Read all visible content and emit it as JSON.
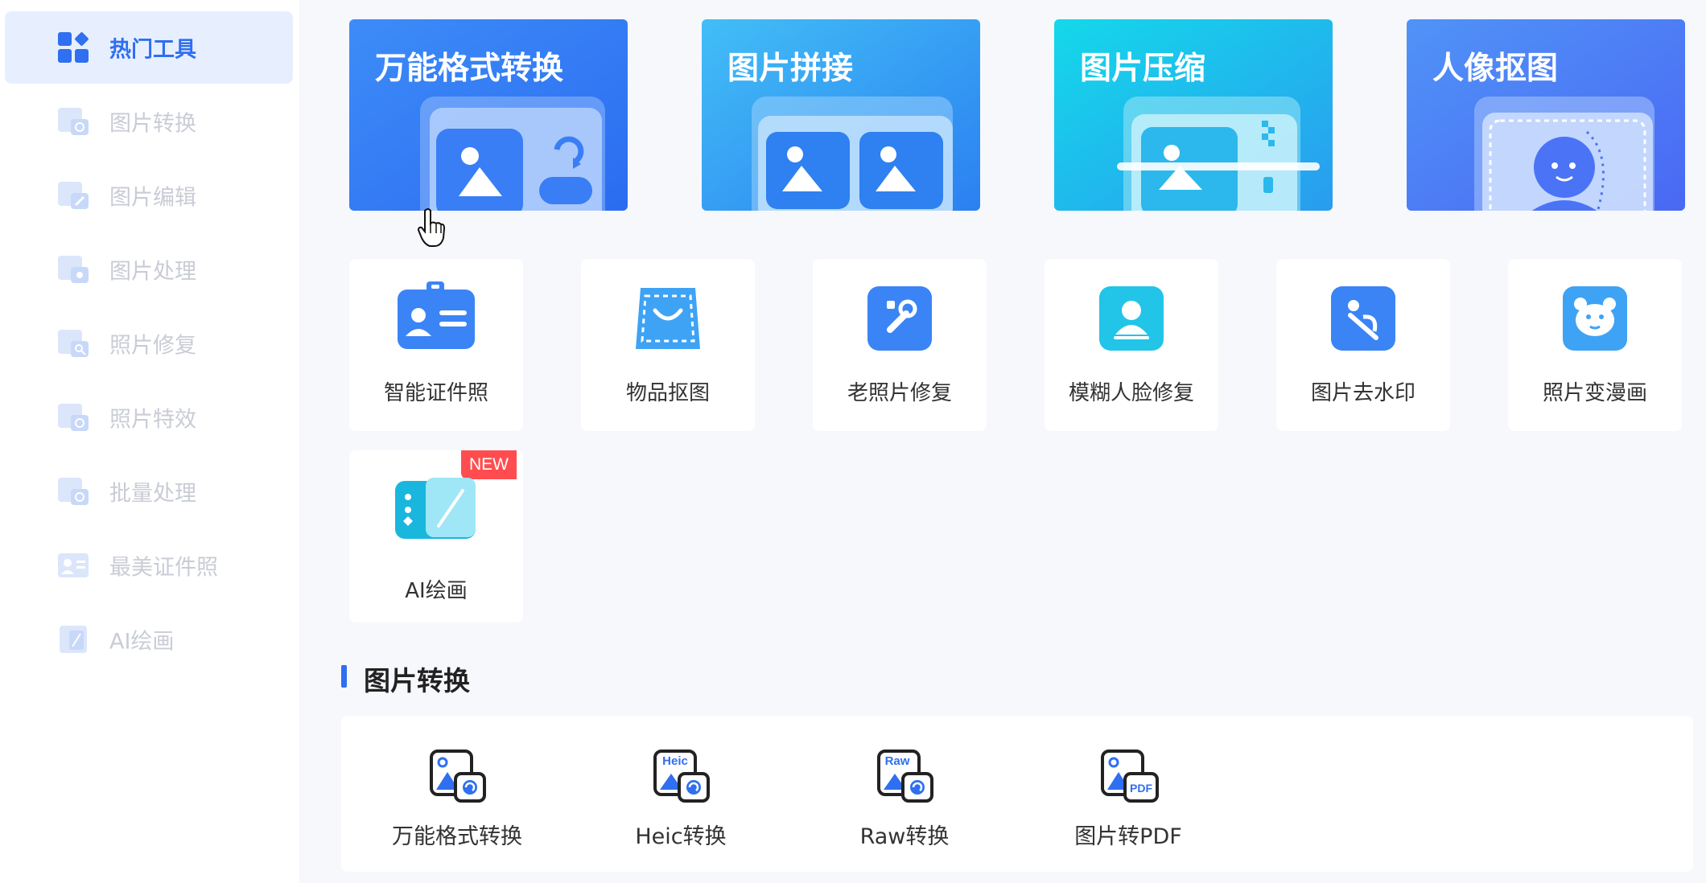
{
  "sidebar": {
    "items": [
      {
        "label": "热门工具",
        "icon": "grid-apps-icon",
        "active": true
      },
      {
        "label": "图片转换",
        "icon": "image-convert-icon"
      },
      {
        "label": "图片编辑",
        "icon": "image-edit-icon"
      },
      {
        "label": "图片处理",
        "icon": "image-process-icon"
      },
      {
        "label": "照片修复",
        "icon": "photo-repair-icon"
      },
      {
        "label": "照片特效",
        "icon": "photo-effect-icon"
      },
      {
        "label": "批量处理",
        "icon": "batch-process-icon"
      },
      {
        "label": "最美证件照",
        "icon": "id-photo-icon"
      },
      {
        "label": "AI绘画",
        "icon": "ai-paint-icon"
      }
    ]
  },
  "banners": [
    {
      "title": "万能格式转换",
      "icon": "format-convert-icon",
      "color_from": "#3b86f7",
      "color_to": "#2f6ff0"
    },
    {
      "title": "图片拼接",
      "icon": "image-stitch-icon",
      "color_from": "#40b8f5",
      "color_to": "#2d86f2"
    },
    {
      "title": "图片压缩",
      "icon": "image-compress-icon",
      "color_from": "#18d3ea",
      "color_to": "#2ba4ef"
    },
    {
      "title": "人像抠图",
      "icon": "portrait-cutout-icon",
      "color_from": "#4f8df6",
      "color_to": "#4a6cf5"
    }
  ],
  "tools": [
    {
      "label": "智能证件照",
      "icon": "id-card-icon"
    },
    {
      "label": "物品抠图",
      "icon": "object-cutout-icon"
    },
    {
      "label": "老照片修复",
      "icon": "old-photo-repair-icon"
    },
    {
      "label": "模糊人脸修复",
      "icon": "blur-face-repair-icon"
    },
    {
      "label": "图片去水印",
      "icon": "remove-watermark-icon"
    },
    {
      "label": "照片变漫画",
      "icon": "photo-to-comic-icon"
    },
    {
      "label": "AI绘画",
      "icon": "ai-painting-icon",
      "badge": "NEW"
    }
  ],
  "section": {
    "title": "图片转换",
    "items": [
      {
        "label": "万能格式转换",
        "icon": "format-convert-icon",
        "tag": ""
      },
      {
        "label": "Heic转换",
        "icon": "heic-convert-icon",
        "tag": "Heic"
      },
      {
        "label": "Raw转换",
        "icon": "raw-convert-icon",
        "tag": "Raw"
      },
      {
        "label": "图片转PDF",
        "icon": "image-to-pdf-icon",
        "tag": "PDF"
      }
    ]
  },
  "colors": {
    "accent": "#2f6ff0",
    "badge": "#ff4d4f",
    "sidebar_inactive": "#c9ccd6"
  }
}
